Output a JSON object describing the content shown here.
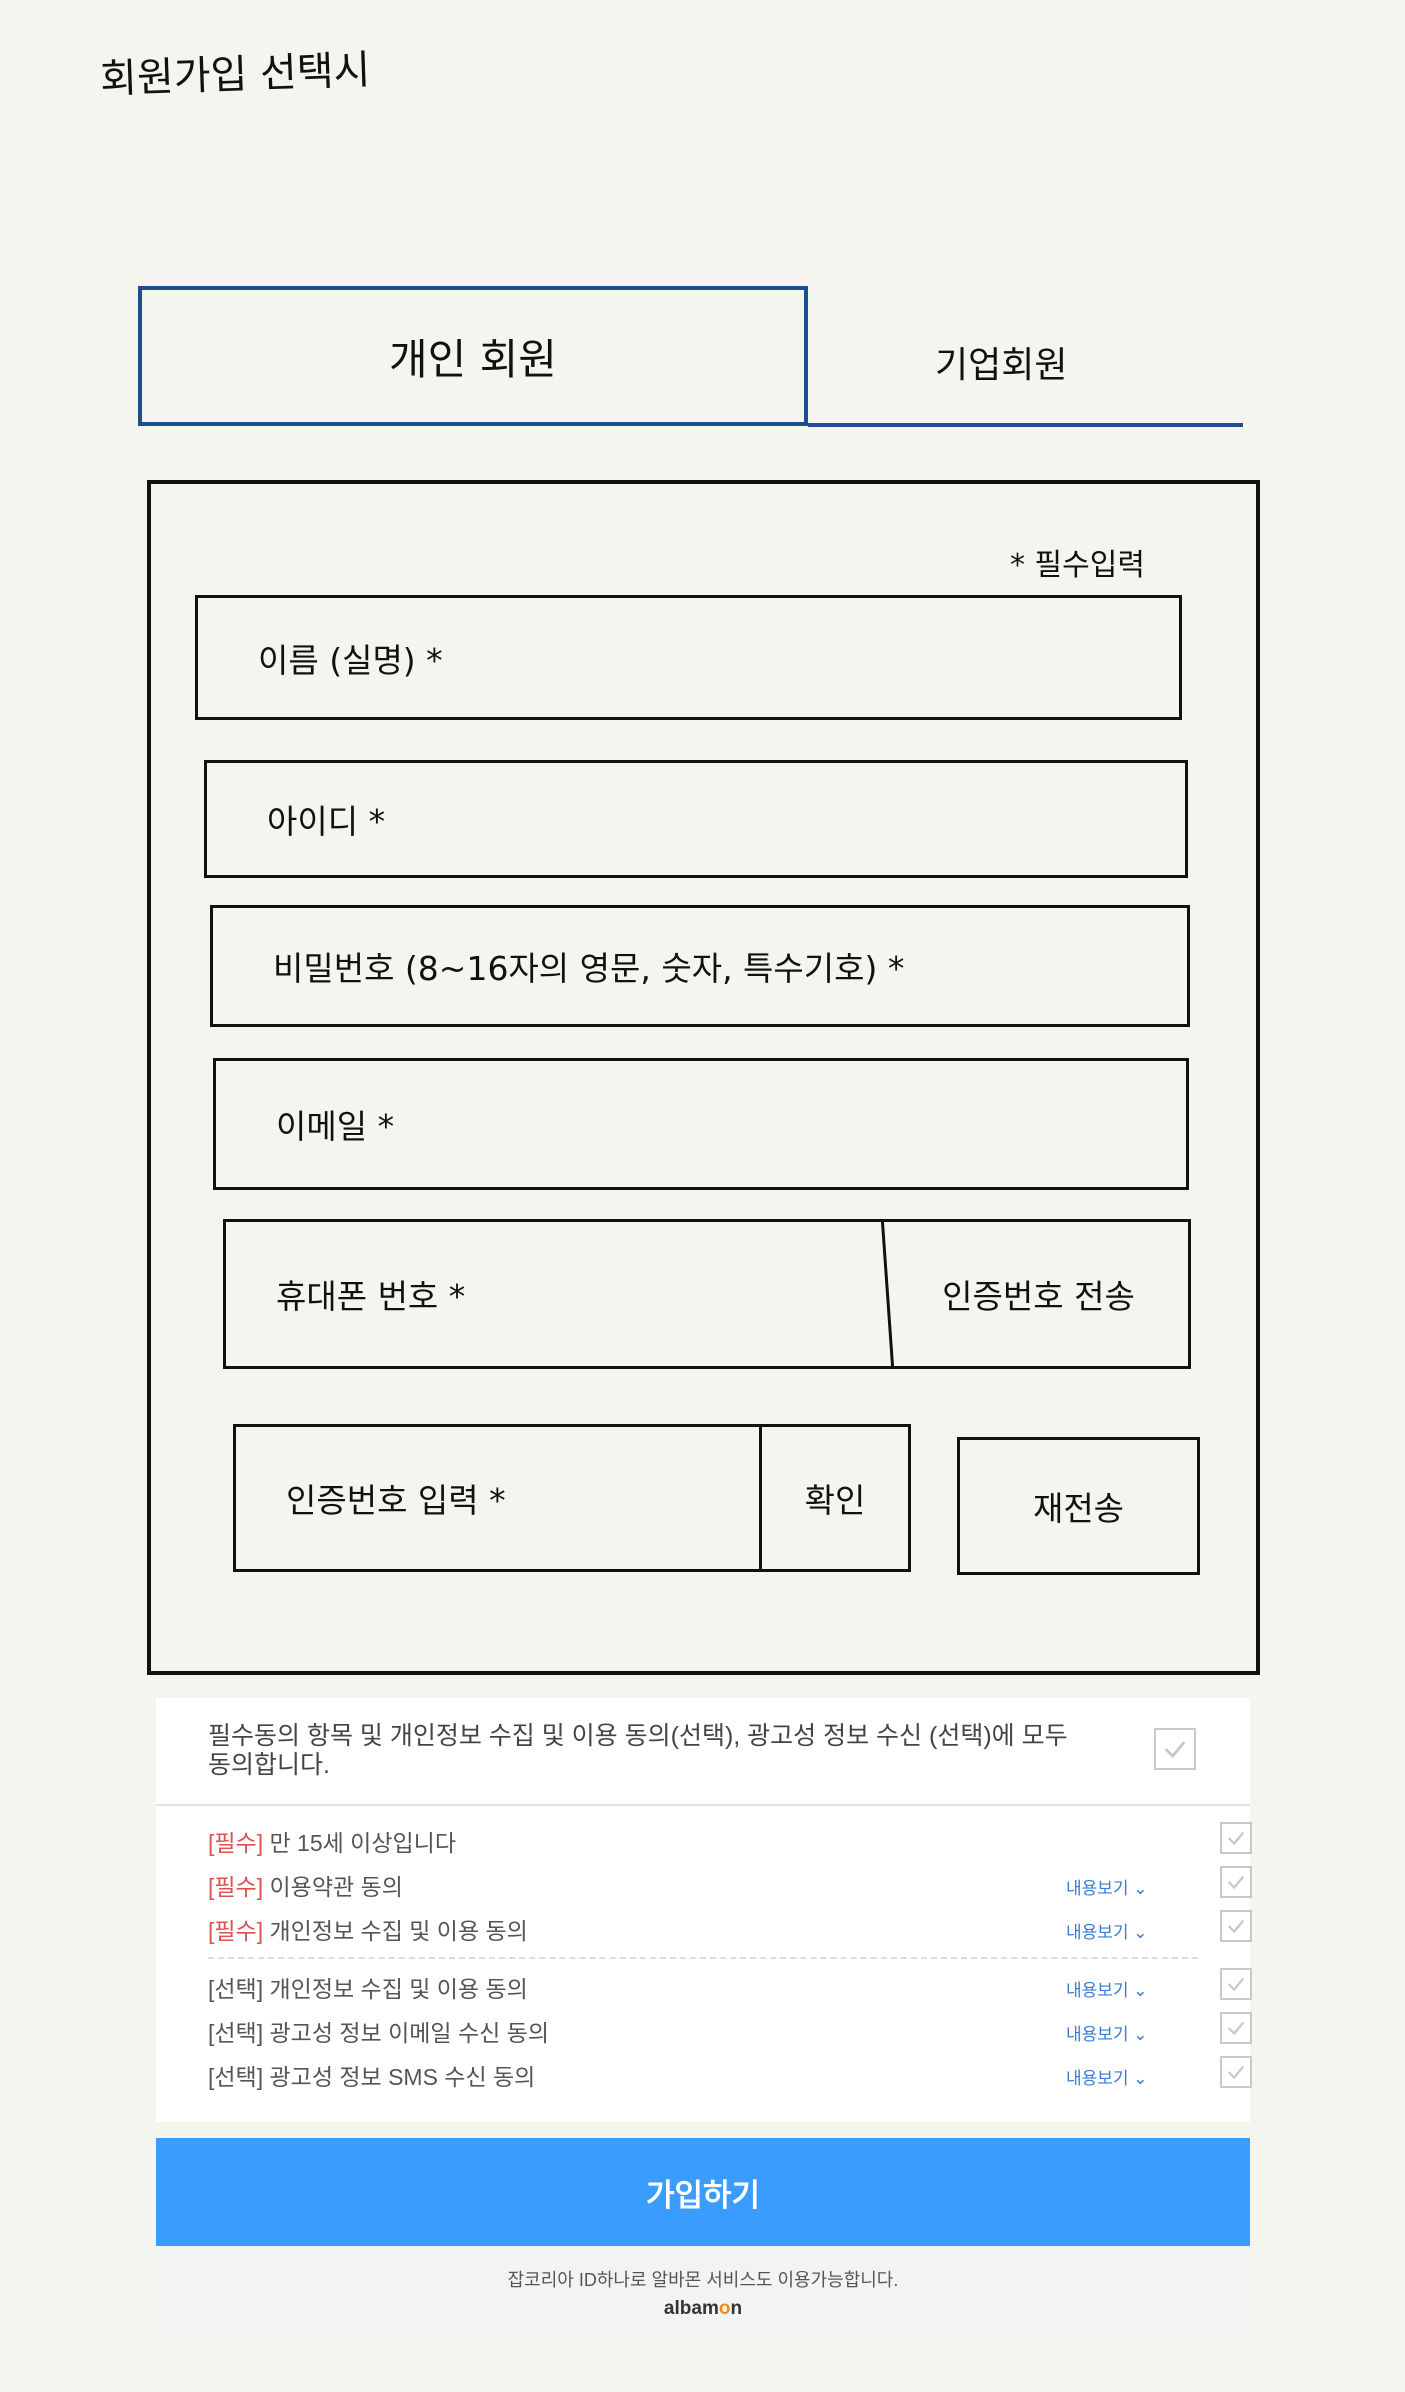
{
  "page": {
    "title": "회원가입 선택시"
  },
  "tabs": {
    "personal": "개인 회원",
    "company": "기업회원"
  },
  "form": {
    "required_note": "* 필수입력",
    "name_label": "이름 (실명) *",
    "id_label": "아이디 *",
    "password_label": "비밀번호 (8~16자의 영문, 숫자, 특수기호) *",
    "email_label": "이메일 *",
    "phone_label": "휴대폰 번호 *",
    "send_code_label": "인증번호 전송",
    "code_label": "인증번호 입력 *",
    "confirm_label": "확인",
    "resend_label": "재전송"
  },
  "agreements": {
    "all_text": "필수동의 항목 및 개인정보 수집 및 이용 동의(선택), 광고성 정보 수신 (선택)에 모두 동의합니다.",
    "view_label": "내용보기",
    "items": [
      {
        "tag": "[필수]",
        "text": " 만 15세 이상입니다",
        "has_view": false
      },
      {
        "tag": "[필수]",
        "text": " 이용약관 동의",
        "has_view": true
      },
      {
        "tag": "[필수]",
        "text": " 개인정보 수집 및 이용 동의",
        "has_view": true
      },
      {
        "tag": "[선택]",
        "text": " 개인정보 수집 및 이용 동의",
        "has_view": true
      },
      {
        "tag": "[선택]",
        "text": " 광고성 정보 이메일 수신 동의",
        "has_view": true
      },
      {
        "tag": "[선택]",
        "text": " 광고성 정보 SMS 수신 동의",
        "has_view": true
      }
    ]
  },
  "submit": {
    "label": "가입하기"
  },
  "footer": {
    "text": "잡코리아 ID하나로 알바몬 서비스도 이용가능합니다.",
    "logo_a": "albam",
    "logo_o": "o",
    "logo_b": "n"
  },
  "colors": {
    "tab_border": "#1f4e8c",
    "submit_bg": "#3a9cff",
    "required_tag": "#d9534f",
    "view_link": "#3a7bd5"
  }
}
